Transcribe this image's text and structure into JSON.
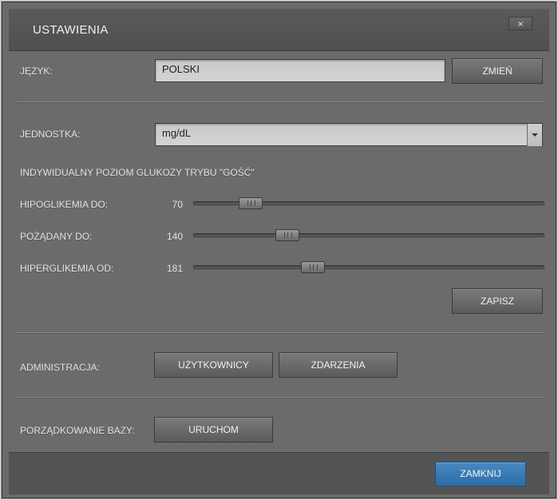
{
  "dialog": {
    "title": "USTAWIENIA",
    "close_icon": "close-icon",
    "close_glyph": "×"
  },
  "language": {
    "label": "JĘZYK:",
    "value": "POLSKI",
    "change_button": "ZMIEŃ"
  },
  "unit": {
    "label": "JEDNOSTKA:",
    "value": "mg/dL"
  },
  "guest_levels": {
    "heading": "INDYWIDUALNY POZIOM GLUKOZY TRYBU \"GOŚĆ\"",
    "sliders": [
      {
        "label": "HIPOGLIKEMIA DO:",
        "value": "70",
        "level": 0.14
      },
      {
        "label": "POŻĄDANY DO:",
        "value": "140",
        "level": 0.25
      },
      {
        "label": "HIPERGLIKEMIA OD:",
        "value": "181",
        "level": 0.33
      }
    ],
    "save_button": "ZAPISZ"
  },
  "administration": {
    "label": "ADMINISTRACJA:",
    "users_button": "UŻYTKOWNICY",
    "events_button": "ZDARZENIA"
  },
  "database": {
    "label": "PORZĄDKOWANIE BAZY:",
    "run_button": "URUCHOM"
  },
  "footer": {
    "close_button": "ZAMKNIJ"
  }
}
